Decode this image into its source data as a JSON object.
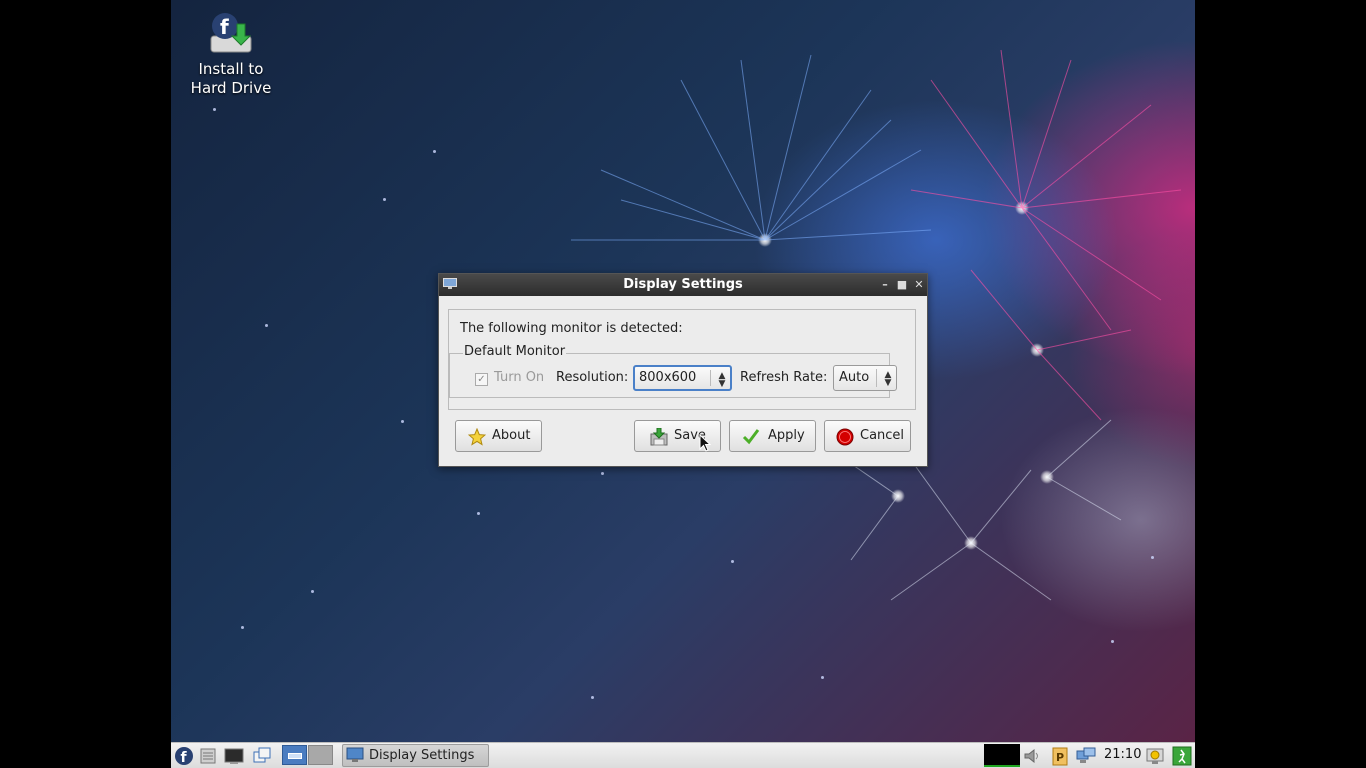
{
  "desktop": {
    "icons": [
      {
        "label": "Install to\nHard Drive",
        "icon": "fedora-install-icon"
      }
    ]
  },
  "dialog": {
    "title": "Display Settings",
    "window_icon": "monitor-icon",
    "controls": [
      "minimize",
      "maximize",
      "close"
    ],
    "detected_text": "The following monitor is detected:",
    "monitor_group": {
      "legend": "Default Monitor",
      "turn_on_label": "Turn On",
      "turn_on_checked": true,
      "turn_on_enabled": false,
      "resolution_label": "Resolution:",
      "resolution_value": "800x600",
      "refresh_label": "Refresh Rate:",
      "refresh_value": "Auto"
    },
    "buttons": {
      "about": "About",
      "save": "Save",
      "apply": "Apply",
      "cancel": "Cancel"
    }
  },
  "taskbar": {
    "launchers": [
      "fedora-menu-icon",
      "file-manager-icon",
      "terminal-icon",
      "windows-icon"
    ],
    "pager": [
      "workspace-1",
      "workspace-2"
    ],
    "task": {
      "label": "Display Settings",
      "icon": "monitor-icon"
    },
    "tray": [
      "cpu-monitor-icon",
      "volume-icon",
      "clipboard-icon",
      "network-icon"
    ],
    "clock": "21:10",
    "end_icons": [
      "update-icon",
      "logout-icon"
    ]
  },
  "colors": {
    "accent_focus": "#4a80c8",
    "titlebar": "#2c2c2c",
    "dialog_bg": "#ececec",
    "cancel_red": "#d40000",
    "apply_green": "#4caf28"
  }
}
